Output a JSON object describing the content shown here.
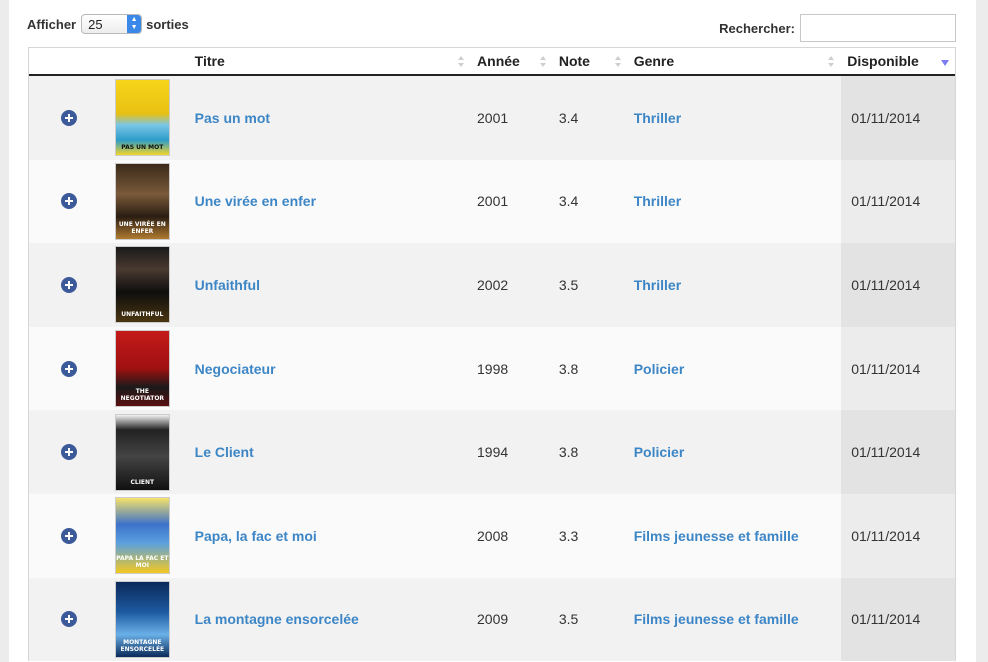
{
  "length_control": {
    "label_before": "Afficher",
    "selected": "25",
    "label_after": "sorties"
  },
  "search": {
    "label": "Rechercher:",
    "value": ""
  },
  "table": {
    "columns": {
      "title": "Titre",
      "year": "Année",
      "note": "Note",
      "genre": "Genre",
      "available": "Disponible"
    },
    "sort": {
      "column": "Disponible",
      "direction": "descending"
    },
    "rows": [
      {
        "title": "Pas un mot",
        "year": "2001",
        "note": "3.4",
        "genre": "Thriller",
        "available": "01/11/2014",
        "poster_text": "PAS UN MOT"
      },
      {
        "title": "Une virée en enfer",
        "year": "2001",
        "note": "3.4",
        "genre": "Thriller",
        "available": "01/11/2014",
        "poster_text": "UNE VIRÉE EN ENFER"
      },
      {
        "title": "Unfaithful",
        "year": "2002",
        "note": "3.5",
        "genre": "Thriller",
        "available": "01/11/2014",
        "poster_text": "UNFAITHFUL"
      },
      {
        "title": "Negociateur",
        "year": "1998",
        "note": "3.8",
        "genre": "Policier",
        "available": "01/11/2014",
        "poster_text": "THE NEGOTIATOR"
      },
      {
        "title": "Le Client",
        "year": "1994",
        "note": "3.8",
        "genre": "Policier",
        "available": "01/11/2014",
        "poster_text": "CLIENT"
      },
      {
        "title": "Papa, la fac et moi",
        "year": "2008",
        "note": "3.3",
        "genre": "Films jeunesse et famille",
        "available": "01/11/2014",
        "poster_text": "PAPA LA FAC ET MOI"
      },
      {
        "title": "La montagne ensorcelée",
        "year": "2009",
        "note": "3.5",
        "genre": "Films jeunesse et famille",
        "available": "01/11/2014",
        "poster_text": "MONTAGNE ENSORCELÉE"
      }
    ]
  }
}
